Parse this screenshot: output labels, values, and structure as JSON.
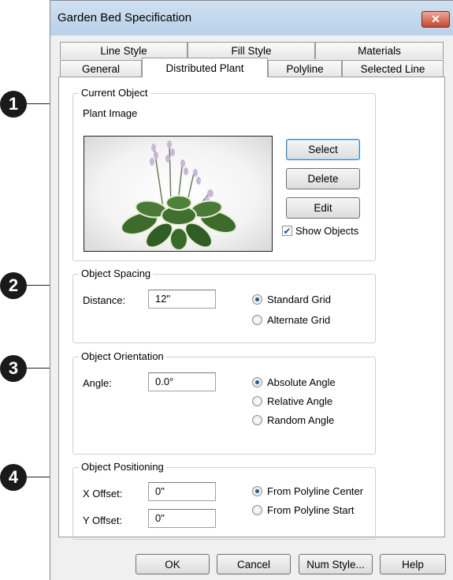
{
  "callouts": [
    "1",
    "2",
    "3",
    "4"
  ],
  "window": {
    "title": "Garden Bed Specification",
    "close_glyph": "✕"
  },
  "tabs": {
    "row_back": [
      "Line Style",
      "Fill Style",
      "Materials"
    ],
    "row_front": [
      "General",
      "Distributed Plant",
      "Polyline",
      "Selected Line"
    ],
    "active": "Distributed Plant"
  },
  "current_object": {
    "legend": "Current Object",
    "image_label": "Plant Image",
    "select_label": "Select",
    "delete_label": "Delete",
    "edit_label": "Edit",
    "show_objects_label": "Show Objects",
    "show_objects_checked": true
  },
  "object_spacing": {
    "legend": "Object Spacing",
    "distance_label": "Distance:",
    "distance_value": "12\"",
    "options": [
      "Standard Grid",
      "Alternate Grid"
    ],
    "selected": "Standard Grid"
  },
  "object_orientation": {
    "legend": "Object Orientation",
    "angle_label": "Angle:",
    "angle_value": "0.0°",
    "options": [
      "Absolute Angle",
      "Relative Angle",
      "Random Angle"
    ],
    "selected": "Absolute Angle"
  },
  "object_positioning": {
    "legend": "Object Positioning",
    "x_label": "X Offset:",
    "x_value": "0\"",
    "y_label": "Y Offset:",
    "y_value": "0\"",
    "options": [
      "From Polyline Center",
      "From Polyline Start"
    ],
    "selected": "From Polyline Center"
  },
  "footer": {
    "ok_label": "OK",
    "cancel_label": "Cancel",
    "num_style_label": "Num Style...",
    "help_label": "Help"
  },
  "colors": {
    "titlebar": "#b9d1ea",
    "close": "#c7462e",
    "callout": "#1a1a1a",
    "radio_dot": "#1d5a9e"
  }
}
